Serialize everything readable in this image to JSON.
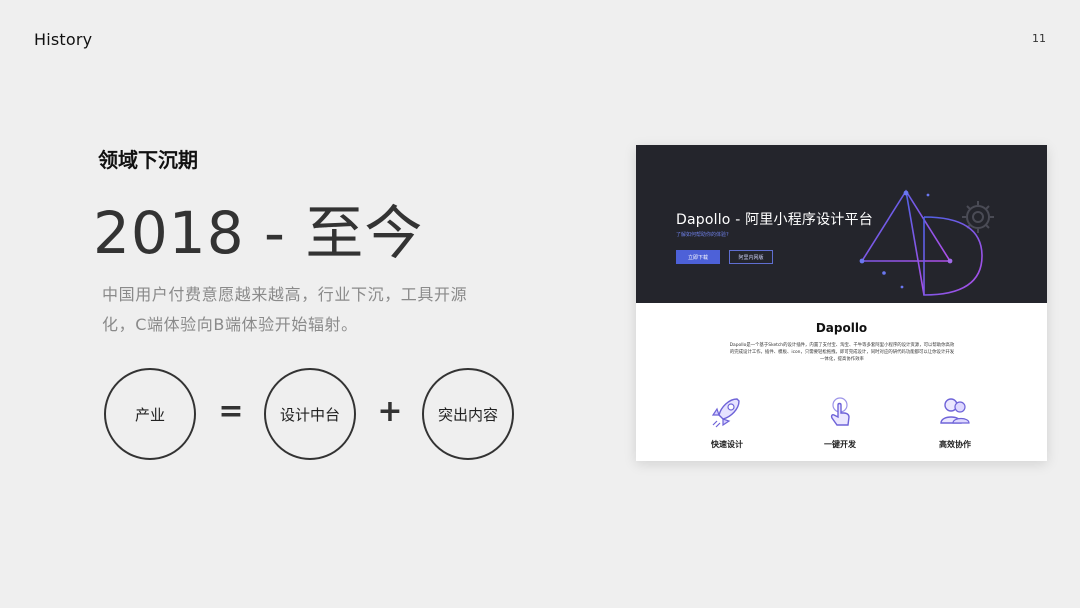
{
  "header": {
    "title": "History",
    "page_number": "11"
  },
  "section": {
    "label": "领域下沉期",
    "headline": "2018 - 至今",
    "description": "中国用户付费意愿越来越高，行业下沉，工具开源化，C端体验向B端体验开始辐射。"
  },
  "formula": {
    "term1": "产业",
    "op1": "=",
    "term2": "设计中台",
    "op2": "+",
    "term3": "突出内容"
  },
  "screenshot": {
    "hero": {
      "title": "Dapollo - 阿里小程序设计平台",
      "subtitle": "了解如何帮助你的体验?",
      "primary_button": "立即下载",
      "secondary_button": "阿里内网版"
    },
    "content": {
      "title": "Dapollo",
      "description": "Dapollo是一个基于Sketch的设计插件，内置了支付宝、淘宝、千牛等多套阿里小程序的设计资源，可以帮助你高效的完成设计工作，插件、模板、icon，只需要轻松拖拽，即可完成设计，同时对应的研代码功能都可以让你设计开发一体化，提高协作效率",
      "features": [
        {
          "icon": "rocket-icon",
          "label": "快速设计"
        },
        {
          "icon": "touch-icon",
          "label": "一键开发"
        },
        {
          "icon": "people-icon",
          "label": "高效协作"
        }
      ]
    }
  },
  "colors": {
    "background": "#efefef",
    "hero_background": "#24252c",
    "accent": "#4d61d8",
    "accent_gradient_end": "#b04ee8"
  }
}
